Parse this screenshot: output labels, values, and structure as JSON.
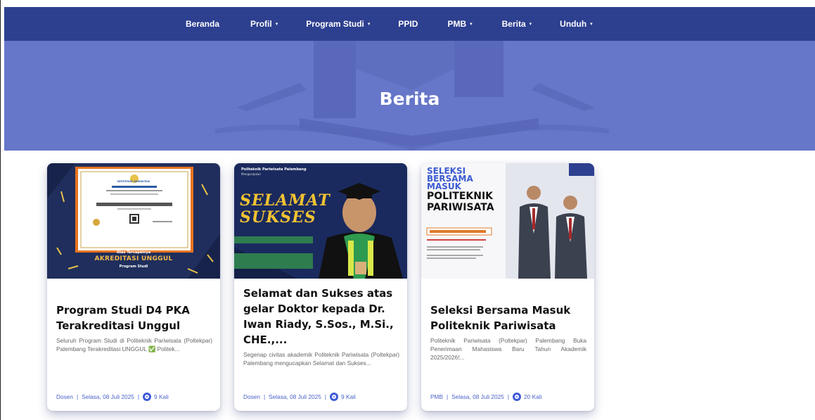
{
  "nav": {
    "items": [
      {
        "label": "Beranda",
        "caret": ""
      },
      {
        "label": "Profil",
        "caret": "▾"
      },
      {
        "label": "Program Studi",
        "caret": "▾"
      },
      {
        "label": "PPID",
        "caret": ""
      },
      {
        "label": "PMB",
        "caret": "▾"
      },
      {
        "label": "Berita",
        "caret": "▾"
      },
      {
        "label": "Unduh",
        "caret": "▾"
      }
    ]
  },
  "hero": {
    "title": "Berita"
  },
  "cards": [
    {
      "image": {
        "badge_line1": "Atas Tercapainya",
        "badge_line2": "AKREDITASI UNGGUL",
        "badge_line3": "Program Studi",
        "cert_title": "SERTIFIKAT AKREDITASI"
      },
      "title": "Program Studi D4 PKA Terakreditasi Unggul",
      "excerpt": "Seluruh Program Studi di Politeknik Pariwisata (Poltekpar) Palembang Terakreditasi UNGGUL ✅ Politek...",
      "meta": {
        "category": "Dosen",
        "date": "Selasa, 08 Juli 2025",
        "views": "9 Kali"
      }
    },
    {
      "image": {
        "header": "Politeknik Pariwisata Palembang",
        "subheader": "Mengucapkan",
        "word1": "SELAMAT",
        "word2": "SUKSES"
      },
      "title": "Selamat dan Sukses atas gelar Doktor kepada Dr. Iwan Riady, S.Sos., M.Si., CHE.,...",
      "excerpt": "Segenap civitas akademik Politeknik Pariwisata (Poltekpar) Palembang mengucapkan Selamat dan Sukses...",
      "meta": {
        "category": "Dosen",
        "date": "Selasa, 08 Juli 2025",
        "views": "9 Kali"
      }
    },
    {
      "image": {
        "line1": "SELEKSI",
        "line2": "BERSAMA",
        "line3": "MASUK",
        "line4": "POLITEKNIK",
        "line5": "PARIWISATA"
      },
      "title": "Seleksi Bersama Masuk Politeknik Pariwisata",
      "excerpt": "Politeknik Pariwisata (Poltekpar) Palembang Buka Penerimaan Mahasiswa Baru Tahun Akademik 2025/2026!...",
      "meta": {
        "category": "PMB",
        "date": "Selasa, 08 Juli 2025",
        "views": "20 Kali"
      }
    }
  ]
}
